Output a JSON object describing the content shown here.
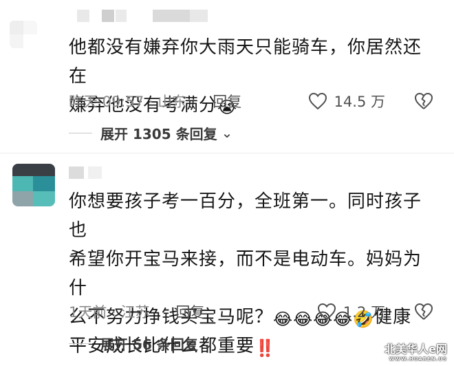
{
  "comments": [
    {
      "text_line1": "他都没有嫌弃你大雨天只能骑车，你居然还在",
      "text_line2": "嫌弃他没有考满分",
      "emoji": "😭",
      "time": "昨天 09:57 · 山东",
      "reply_label": "回复",
      "likes": "14.5 万",
      "expand_label": "展开 1305 条回复",
      "icons": {
        "like": "heart-outline-icon",
        "dislike": "broken-heart-icon",
        "expand": "chevron-down-icon"
      }
    },
    {
      "text_line1": "你想要孩子考一百分，全班第一。同时孩子也",
      "text_line2": "希望你开宝马来接，而不是电动车。妈妈为什",
      "text_line3": "么不努力挣钱买宝马呢？",
      "emojis_line3": [
        "😂",
        "😂",
        "😂",
        "😂",
        "🤣"
      ],
      "text_line3_end": "健康",
      "text_line4": "平安成长比什么都重要",
      "emoji_line4": "‼️",
      "time": "1天前 · 江苏",
      "reply_label": "回复",
      "likes": "1.2 万",
      "expand_label": "展开 56 条回复",
      "icons": {
        "like": "heart-outline-icon",
        "dislike": "broken-heart-icon",
        "expand": "chevron-down-icon"
      }
    }
  ],
  "watermark": {
    "main": "北美华人e网",
    "sub": "WWW.HUAREN.US"
  },
  "colors": {
    "text": "#161616",
    "meta": "#8a8a8a",
    "divider": "#ececec",
    "avatar_teal": "#3fb7b7",
    "avatar_gray": "#9a9a9a"
  }
}
